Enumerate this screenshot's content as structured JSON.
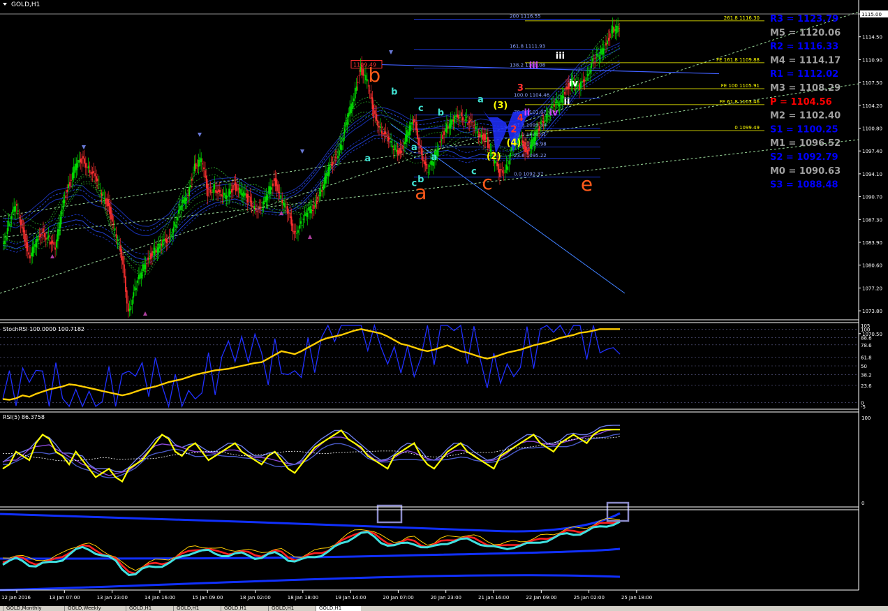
{
  "window": {
    "title": "GOLD,H1"
  },
  "indicators": {
    "stoch": "StochRSI 100.0000 100.7182",
    "rsi": "RSI(5) 86.3758"
  },
  "colors": {
    "background": "#000000",
    "bull": "#00e000",
    "bear": "#ff3030",
    "fib": "#ffff00",
    "fibBlue": "#2040ff",
    "waveOrange": "#ff5a1a",
    "waveCyan": "#40e0d0",
    "stochLine": "#ffcc00",
    "rsiLine": "#ffff00",
    "cyanLine": "#40e0e0",
    "pivotBlue": "#0000ff",
    "pivotGray": "#a0a0a0",
    "pivotRed": "#ff0000"
  },
  "chart_data": {
    "type": "candlestick",
    "symbol": "GOLD",
    "timeframe": "H1",
    "ylim": [
      1070.5,
      1118.0
    ],
    "price_axis_ticks": [
      "1115.00",
      "1114.50",
      "1110.90",
      "1107.50",
      "1104.20",
      "1100.80",
      "1097.40",
      "1094.10",
      "1090.70",
      "1087.30",
      "1083.90",
      "1080.60",
      "1077.20",
      "1073.80",
      "1070.50"
    ],
    "time_axis_ticks": [
      "12 Jan 2016",
      "13 Jan 07:00",
      "13 Jan 23:00",
      "14 Jan 16:00",
      "15 Jan 09:00",
      "18 Jan 02:00",
      "18 Jan 18:00",
      "19 Jan 14:00",
      "20 Jan 07:00",
      "20 Jan 23:00",
      "21 Jan 16:00",
      "22 Jan 09:00",
      "25 Jan 02:00",
      "25 Jan 18:00"
    ],
    "price_path": [
      1082,
      1085,
      1088,
      1085,
      1080,
      1082,
      1084,
      1083,
      1081,
      1088,
      1091,
      1094,
      1095,
      1094,
      1092,
      1090,
      1088,
      1084,
      1080,
      1072,
      1075,
      1078,
      1080,
      1081,
      1082,
      1083,
      1085,
      1088,
      1090,
      1094,
      1095,
      1090,
      1091,
      1089,
      1090,
      1091,
      1090,
      1089,
      1088,
      1087,
      1090,
      1092,
      1089,
      1087,
      1084,
      1085,
      1087,
      1088,
      1090,
      1093,
      1095,
      1097,
      1101,
      1105,
      1109,
      1107,
      1102,
      1100,
      1098,
      1097,
      1096,
      1099,
      1101,
      1097,
      1093,
      1095,
      1098,
      1100,
      1101,
      1102,
      1101,
      1100,
      1099,
      1098,
      1095,
      1093,
      1094,
      1097,
      1099,
      1096,
      1098,
      1100,
      1102,
      1103,
      1104,
      1106,
      1107,
      1106,
      1108,
      1110,
      1111,
      1113,
      1115,
      1115
    ],
    "pivots": [
      {
        "label": "R3 = 1123.79",
        "color": "#0000ff"
      },
      {
        "label": "M5 = 1120.06",
        "color": "#a0a0a0"
      },
      {
        "label": "R2 = 1116.33",
        "color": "#0000ff"
      },
      {
        "label": "M4 = 1114.17",
        "color": "#a0a0a0"
      },
      {
        "label": "R1 = 1112.02",
        "color": "#0000ff"
      },
      {
        "label": "M3 = 1108.29",
        "color": "#a0a0a0"
      },
      {
        "label": "P = 1104.56",
        "color": "#ff0000"
      },
      {
        "label": "M2 = 1102.40",
        "color": "#a0a0a0"
      },
      {
        "label": "S1 = 1100.25",
        "color": "#0000ff"
      },
      {
        "label": "M1 = 1096.52",
        "color": "#a0a0a0"
      },
      {
        "label": "S2 = 1092.79",
        "color": "#0000ff"
      },
      {
        "label": "M0 = 1090.63",
        "color": "#a0a0a0"
      },
      {
        "label": "S3 = 1088.48",
        "color": "#0000ff"
      }
    ],
    "fib_levels": [
      {
        "label": "261.8 1116.30",
        "price": 1116.3
      },
      {
        "label": "FE 161.8 1109.88",
        "price": 1109.88
      },
      {
        "label": "FE 100 1105.91",
        "price": 1105.91
      },
      {
        "label": "FE 61.8 1103.46",
        "price": 1103.46
      },
      {
        "label": "0 1099.49",
        "price": 1099.49
      }
    ],
    "fib_ret": [
      {
        "label": "200 1116.55",
        "price": 1116.55
      },
      {
        "label": "161.8 1111.93",
        "price": 1111.93
      },
      {
        "label": "138.2 1109.08",
        "price": 1109.08
      },
      {
        "label": "100.0 1104.46",
        "price": 1104.46
      },
      {
        "label": "78.6 1101.87",
        "price": 1101.87
      },
      {
        "label": "61.8 1099.84",
        "price": 1099.84
      },
      {
        "label": "50.0 1098.41",
        "price": 1098.41
      },
      {
        "label": "38.2 1096.98",
        "price": 1096.98
      },
      {
        "label": "23.6 1095.22",
        "price": 1095.22
      },
      {
        "label": "0.0 1092.37",
        "price": 1092.37
      }
    ],
    "price_box": "1109.49",
    "current_price": "1115.00",
    "waves_big": [
      {
        "label": "b",
        "price": 1107.0,
        "bar": 56
      },
      {
        "label": "a",
        "price": 1089.0,
        "bar": 63
      },
      {
        "label": "c",
        "price": 1090.5,
        "bar": 73
      },
      {
        "label": "e",
        "price": 1090.3,
        "bar": 88
      }
    ],
    "waves_small": [
      {
        "label": "b",
        "price": 1105.0,
        "bar": 59,
        "color": "#40e0d0"
      },
      {
        "label": "c",
        "price": 1102.5,
        "bar": 63,
        "color": "#40e0d0"
      },
      {
        "label": "b",
        "price": 1101.8,
        "bar": 66,
        "color": "#40e0d0"
      },
      {
        "label": "a",
        "price": 1096.5,
        "bar": 62,
        "color": "#40e0d0"
      },
      {
        "label": "a",
        "price": 1095.0,
        "bar": 65,
        "color": "#40e0d0"
      },
      {
        "label": "a",
        "price": 1094.8,
        "bar": 55,
        "color": "#40e0d0"
      },
      {
        "label": "c",
        "price": 1091.0,
        "bar": 62,
        "color": "#40e0d0"
      },
      {
        "label": "b",
        "price": 1091.6,
        "bar": 63,
        "color": "#40e0d0"
      },
      {
        "label": "c",
        "price": 1092.8,
        "bar": 71,
        "color": "#40e0d0"
      },
      {
        "label": "a",
        "price": 1103.8,
        "bar": 72,
        "color": "#40e0d0"
      },
      {
        "label": "(3)",
        "price": 1102.9,
        "bar": 75,
        "color": "#ffff00"
      },
      {
        "label": "(4)",
        "price": 1097.2,
        "bar": 77,
        "color": "#ffff00"
      },
      {
        "label": "(2)",
        "price": 1095.1,
        "bar": 74,
        "color": "#ffff00"
      },
      {
        "label": "3",
        "price": 1105.6,
        "bar": 78,
        "color": "#ff3030"
      },
      {
        "label": "4",
        "price": 1101.0,
        "bar": 78,
        "color": "#ff3030"
      },
      {
        "label": "2",
        "price": 1099.2,
        "bar": 77,
        "color": "#ff3030"
      },
      {
        "label": "iii",
        "price": 1109.0,
        "bar": 80,
        "color": "#cc44ff"
      },
      {
        "label": "ii",
        "price": 1101.8,
        "bar": 79,
        "color": "#cc44ff"
      },
      {
        "label": "iv",
        "price": 1101.8,
        "bar": 83,
        "color": "#cc44ff"
      },
      {
        "label": "iii",
        "price": 1110.5,
        "bar": 84,
        "color": "#ffffff"
      },
      {
        "label": "iv",
        "price": 1106.3,
        "bar": 86,
        "color": "#ffffff"
      },
      {
        "label": "ii",
        "price": 1103.5,
        "bar": 85,
        "color": "#ffffff"
      }
    ],
    "stoch_ticks": [
      "105",
      "100",
      "88.6",
      "78.6",
      "61.8",
      "50",
      "38.2",
      "23.6",
      "0",
      "-5"
    ],
    "stoch_values": [
      5,
      4,
      6,
      10,
      8,
      12,
      15,
      18,
      20,
      22,
      25,
      24,
      22,
      20,
      18,
      16,
      14,
      12,
      10,
      12,
      15,
      18,
      20,
      22,
      25,
      28,
      30,
      32,
      35,
      38,
      40,
      42,
      44,
      45,
      46,
      48,
      50,
      52,
      54,
      55,
      60,
      65,
      70,
      68,
      66,
      70,
      75,
      80,
      85,
      88,
      90,
      92,
      95,
      98,
      100,
      98,
      96,
      94,
      90,
      85,
      80,
      78,
      75,
      72,
      70,
      72,
      75,
      78,
      74,
      70,
      68,
      65,
      62,
      60,
      62,
      65,
      68,
      70,
      72,
      75,
      78,
      80,
      82,
      85,
      88,
      90,
      92,
      95,
      96,
      98,
      100,
      100,
      100,
      100
    ],
    "rsi_ticks": [
      "100",
      "0"
    ],
    "rsi_values": [
      40,
      45,
      60,
      55,
      50,
      70,
      80,
      75,
      60,
      55,
      45,
      60,
      50,
      40,
      30,
      35,
      40,
      30,
      25,
      40,
      45,
      50,
      60,
      70,
      80,
      75,
      60,
      55,
      65,
      70,
      60,
      50,
      55,
      60,
      65,
      70,
      60,
      55,
      50,
      45,
      55,
      60,
      50,
      40,
      35,
      45,
      55,
      65,
      70,
      75,
      80,
      85,
      75,
      70,
      65,
      55,
      50,
      45,
      40,
      55,
      60,
      65,
      70,
      55,
      45,
      40,
      50,
      60,
      65,
      70,
      60,
      55,
      50,
      45,
      40,
      55,
      60,
      65,
      70,
      75,
      80,
      70,
      65,
      60,
      70,
      75,
      80,
      75,
      70,
      80,
      85,
      86,
      86,
      86
    ],
    "rsi_extras": {
      "color": "#ffff00"
    }
  },
  "tabs": [
    "GOLD,Monthly",
    "GOLD,Weekly",
    "GOLD,H1",
    "GOLD,H1",
    "GOLD,H1",
    "GOLD,H1",
    "GOLD,H1"
  ]
}
